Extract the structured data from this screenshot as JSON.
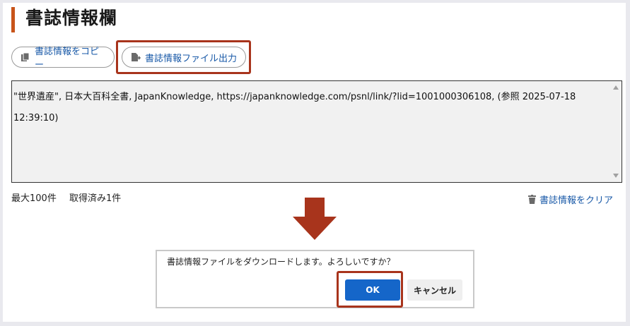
{
  "page": {
    "title": "書誌情報欄",
    "accent_color": "#c8541a",
    "highlight_color": "#a8341c"
  },
  "toolbar": {
    "copy_label": "書誌情報をコピー",
    "copy_icon": "copy-icon",
    "export_label": "書誌情報ファイル出力",
    "export_icon": "file-export-icon"
  },
  "citation": {
    "text": "\"世界遺産\", 日本大百科全書, JapanKnowledge, https://japanknowledge.com/psnl/link/?lid=1001000306108, (参照 2025-07-18 12:39:10)"
  },
  "status": {
    "max_label": "最大100件",
    "fetched_label": "取得済み1件"
  },
  "clear": {
    "label": "書誌情報をクリア",
    "icon": "trash-icon"
  },
  "dialog": {
    "message": "書誌情報ファイルをダウンロードします。よろしいですか？",
    "ok_label": "OK",
    "cancel_label": "キャンセル",
    "ok_color": "#1566c9"
  }
}
